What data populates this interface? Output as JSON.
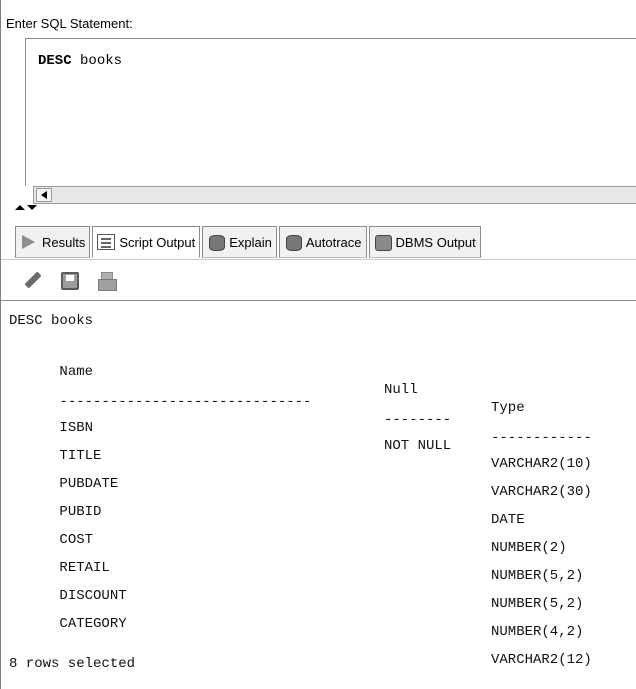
{
  "statement_label": "Enter SQL Statement:",
  "editor": {
    "keyword": "DESC",
    "rest": " books"
  },
  "tabs": [
    {
      "label": "Results",
      "icon": "play-icon",
      "active": false
    },
    {
      "label": "Script Output",
      "icon": "script-icon",
      "active": true
    },
    {
      "label": "Explain",
      "icon": "explain-icon",
      "active": false
    },
    {
      "label": "Autotrace",
      "icon": "autotrace-icon",
      "active": false
    },
    {
      "label": "DBMS Output",
      "icon": "dbms-icon",
      "active": false
    }
  ],
  "toolbar": {
    "icons": [
      "pencil-icon",
      "save-icon",
      "print-icon"
    ]
  },
  "output": {
    "command": "DESC books",
    "headers": {
      "name": "Name",
      "null": "Null",
      "type": "Type"
    },
    "separators": {
      "name": "------------------------------",
      "null": "--------",
      "type": "------------"
    },
    "rows": [
      {
        "name": "ISBN",
        "null": "NOT NULL",
        "type": "VARCHAR2(10)"
      },
      {
        "name": "TITLE",
        "null": "",
        "type": "VARCHAR2(30)"
      },
      {
        "name": "PUBDATE",
        "null": "",
        "type": "DATE"
      },
      {
        "name": "PUBID",
        "null": "",
        "type": "NUMBER(2)"
      },
      {
        "name": "COST",
        "null": "",
        "type": "NUMBER(5,2)"
      },
      {
        "name": "RETAIL",
        "null": "",
        "type": "NUMBER(5,2)"
      },
      {
        "name": "DISCOUNT",
        "null": "",
        "type": "NUMBER(4,2)"
      },
      {
        "name": "CATEGORY",
        "null": "",
        "type": "VARCHAR2(12)"
      }
    ],
    "footer": "8 rows selected"
  }
}
